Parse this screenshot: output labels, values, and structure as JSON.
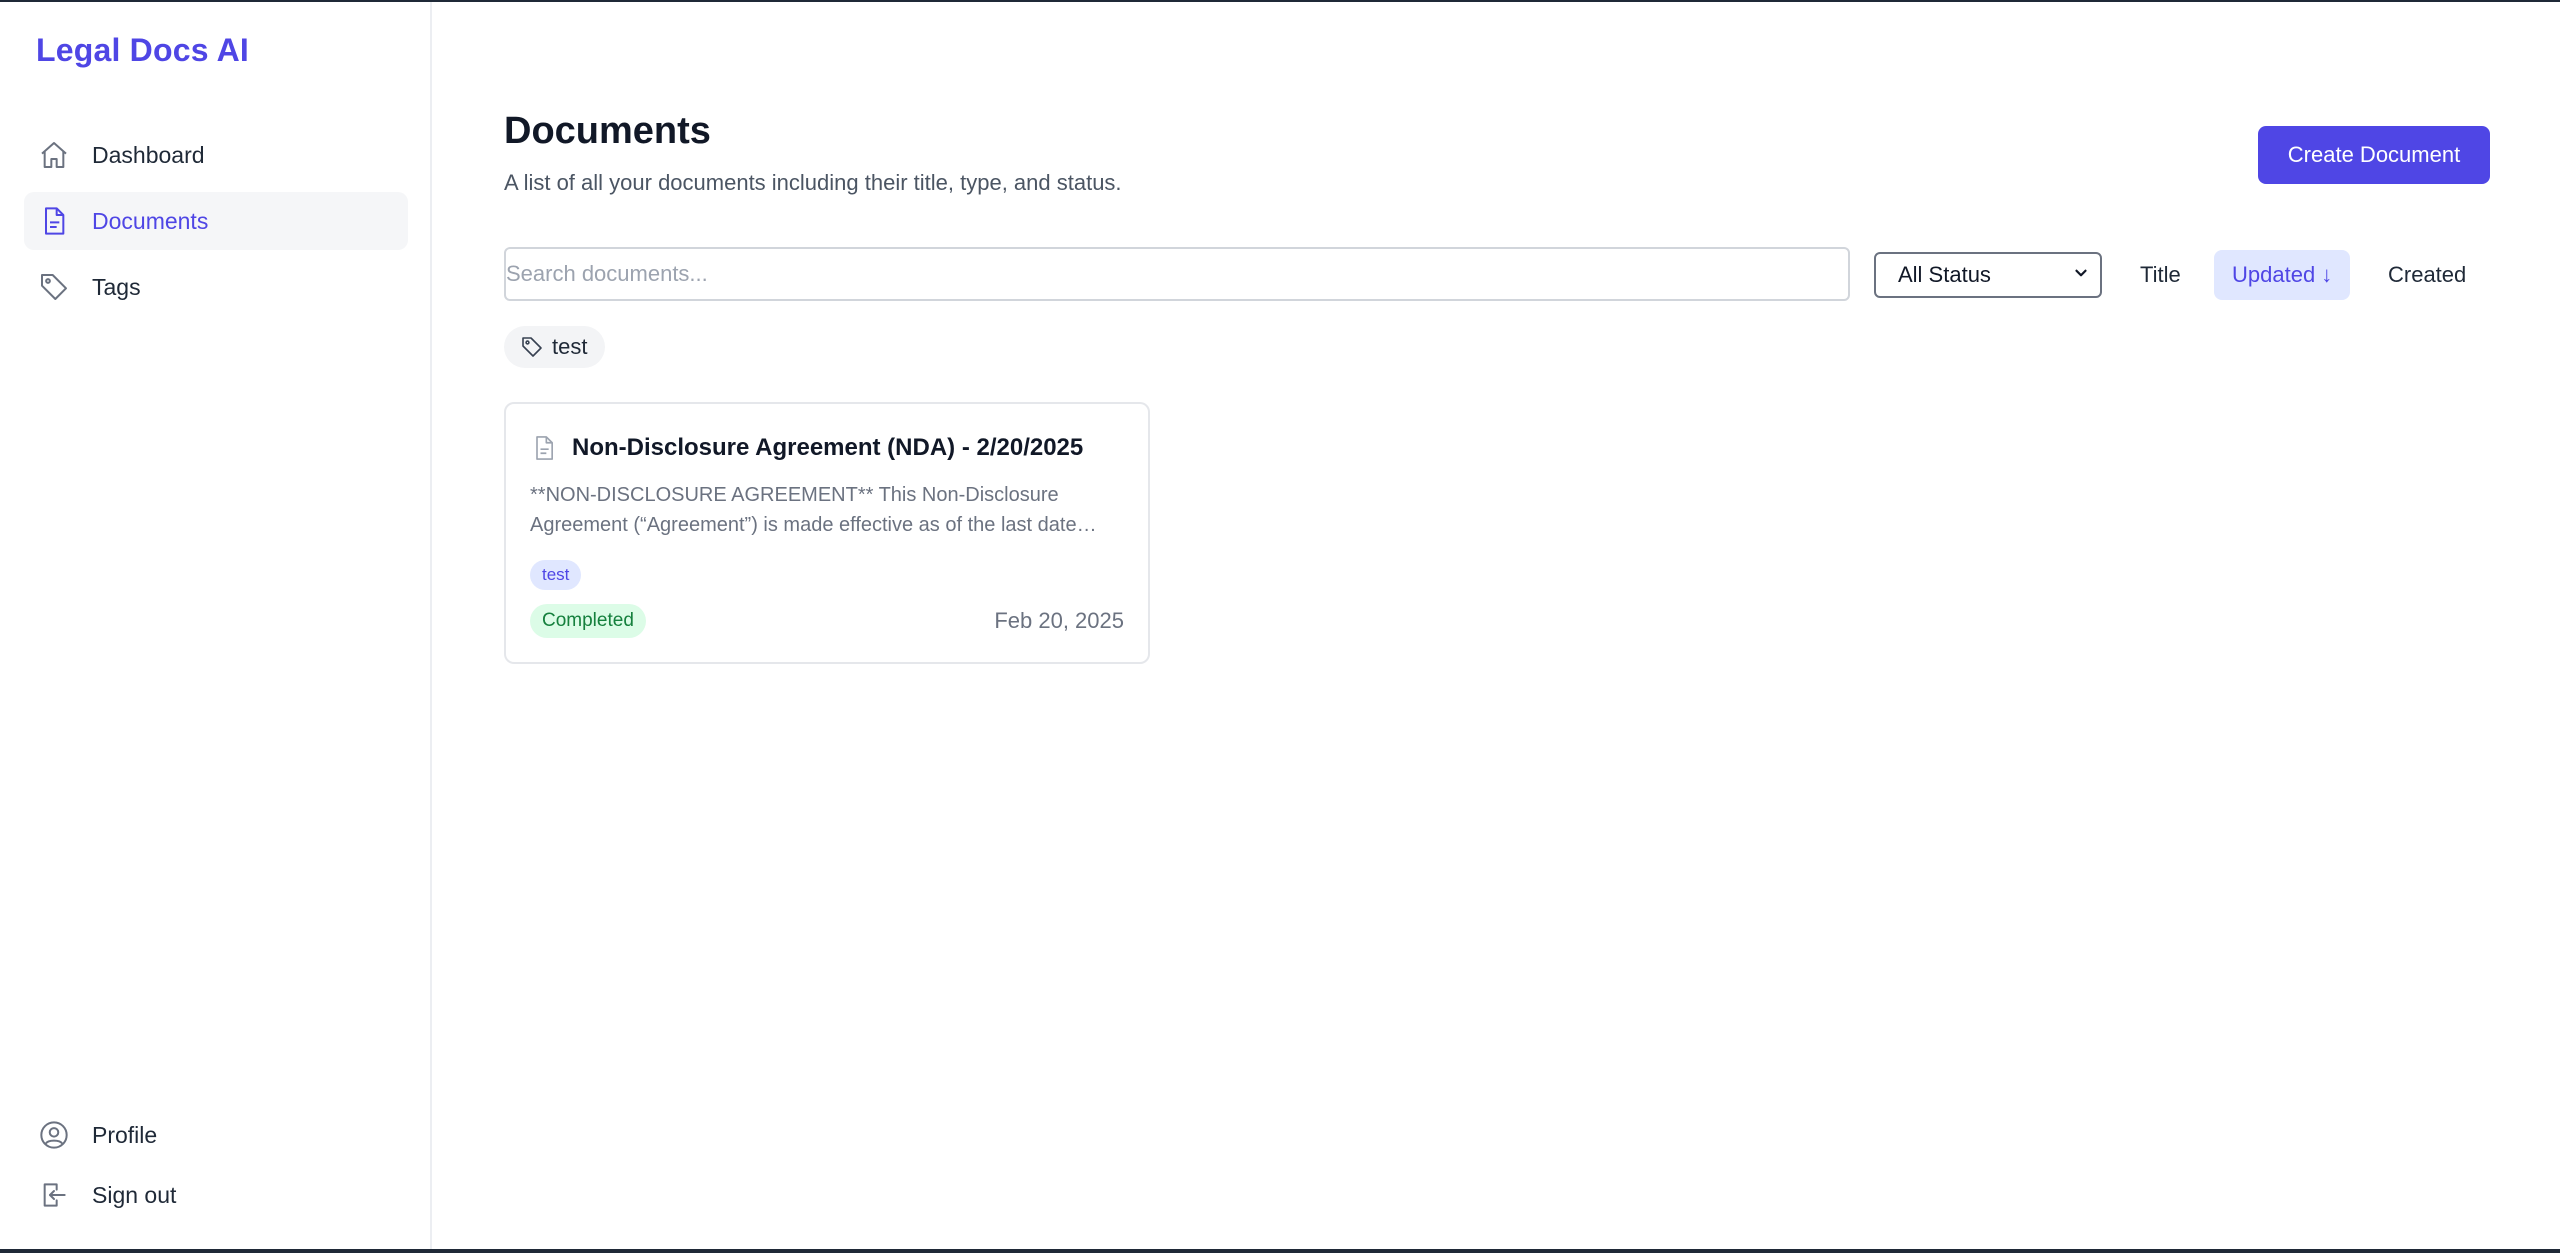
{
  "app": {
    "brand": "Legal Docs AI",
    "accent_color": "#4f46e5"
  },
  "sidebar": {
    "items": [
      {
        "label": "Dashboard",
        "icon": "home-icon",
        "active": false
      },
      {
        "label": "Documents",
        "icon": "document-icon",
        "active": true
      },
      {
        "label": "Tags",
        "icon": "tag-icon",
        "active": false
      }
    ],
    "bottom_items": [
      {
        "label": "Profile",
        "icon": "user-circle-icon"
      },
      {
        "label": "Sign out",
        "icon": "sign-out-icon"
      }
    ]
  },
  "header": {
    "title": "Documents",
    "subtitle": "A list of all your documents including their title, type, and status.",
    "create_button_label": "Create Document"
  },
  "filters": {
    "search_placeholder": "Search documents...",
    "search_value": "",
    "status_selected": "All Status",
    "sort_options": [
      {
        "label": "Title",
        "active": false
      },
      {
        "label": "Updated ↓",
        "active": true
      },
      {
        "label": "Created",
        "active": false
      }
    ],
    "tag_filters": [
      {
        "label": "test",
        "icon": "tag-icon"
      }
    ]
  },
  "documents": [
    {
      "title": "Non-Disclosure Agreement (NDA) - 2/20/2025",
      "excerpt": "**NON-DISCLOSURE AGREEMENT** This Non-Disclosure Agreement (“Agreement”) is made effective as of the last date written below (the “Effective Date”), by and between the parties.",
      "tags": [
        "test"
      ],
      "status": "Completed",
      "status_color": "#15803d",
      "date": "Feb 20, 2025"
    }
  ]
}
